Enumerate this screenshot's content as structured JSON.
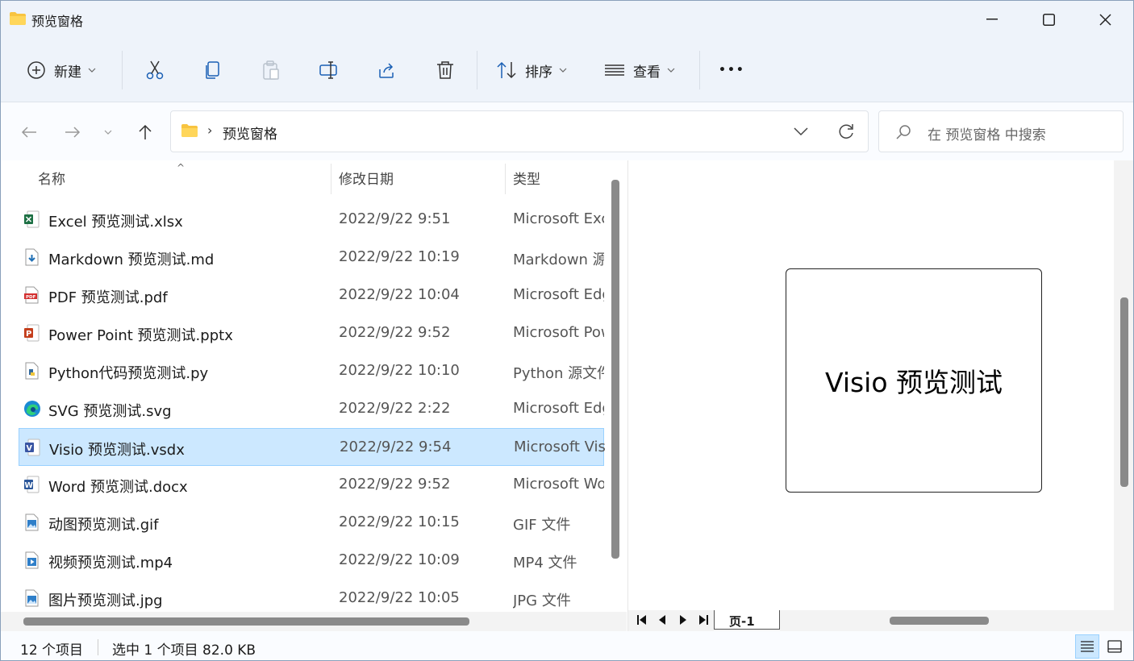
{
  "window": {
    "title": "预览窗格"
  },
  "toolbar": {
    "new_label": "新建",
    "sort_label": "排序",
    "view_label": "查看",
    "more_label": "•••"
  },
  "address": {
    "chevron": "›",
    "path": "预览窗格"
  },
  "search": {
    "placeholder": "在 预览窗格 中搜索"
  },
  "columns": {
    "name": "名称",
    "date": "修改日期",
    "type": "类型"
  },
  "files": [
    {
      "name": "Excel 预览测试.xlsx",
      "date": "2022/9/22 9:51",
      "type": "Microsoft Excel",
      "icon": "excel-icon"
    },
    {
      "name": "Markdown 预览测试.md",
      "date": "2022/9/22 10:19",
      "type": "Markdown 源文件",
      "icon": "markdown-icon"
    },
    {
      "name": "PDF 预览测试.pdf",
      "date": "2022/9/22 10:04",
      "type": "Microsoft Edge",
      "icon": "pdf-icon"
    },
    {
      "name": "Power Point 预览测试.pptx",
      "date": "2022/9/22 9:52",
      "type": "Microsoft PowerPoint",
      "icon": "powerpoint-icon"
    },
    {
      "name": "Python代码预览测试.py",
      "date": "2022/9/22 10:10",
      "type": "Python 源文件",
      "icon": "python-icon"
    },
    {
      "name": "SVG 预览测试.svg",
      "date": "2022/9/22 2:22",
      "type": "Microsoft Edge",
      "icon": "edge-icon"
    },
    {
      "name": "Visio 预览测试.vsdx",
      "date": "2022/9/22 9:54",
      "type": "Microsoft Visio",
      "icon": "visio-icon",
      "selected": true
    },
    {
      "name": "Word 预览测试.docx",
      "date": "2022/9/22 9:52",
      "type": "Microsoft Word",
      "icon": "word-icon"
    },
    {
      "name": "动图预览测试.gif",
      "date": "2022/9/22 10:15",
      "type": "GIF 文件",
      "icon": "image-icon"
    },
    {
      "name": "视频预览测试.mp4",
      "date": "2022/9/22 10:09",
      "type": "MP4 文件",
      "icon": "video-icon"
    },
    {
      "name": "图片预览测试.jpg",
      "date": "2022/9/22 10:05",
      "type": "JPG 文件",
      "icon": "image-icon"
    }
  ],
  "preview": {
    "content": "Visio 预览测试",
    "page_tab": "页-1"
  },
  "status": {
    "count": "12 个项目",
    "selection": "选中 1 个项目  82.0 KB"
  },
  "colors": {
    "selected_bg": "#cce8ff",
    "selected_border": "#99d1ff",
    "chrome_bg": "#eef3fa"
  }
}
